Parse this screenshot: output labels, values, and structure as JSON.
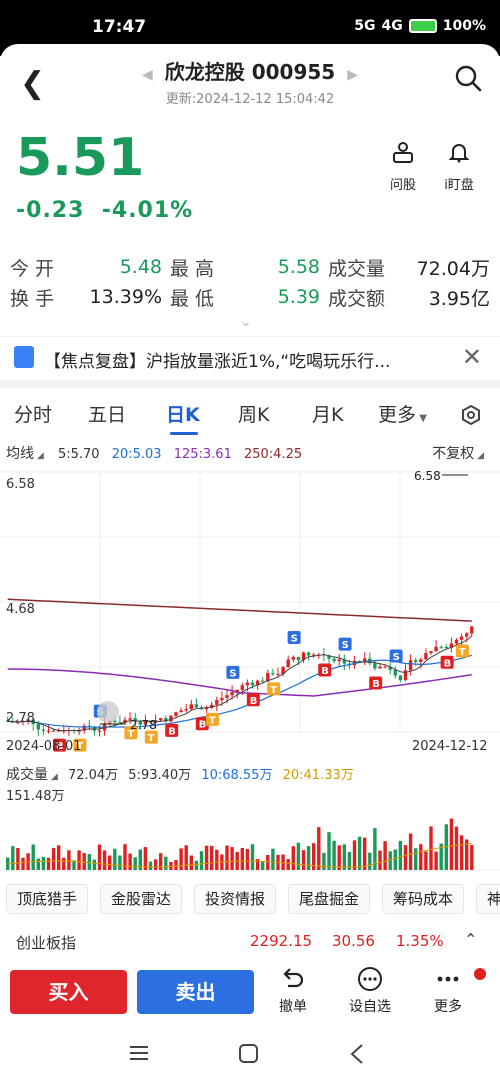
{
  "status": {
    "time": "17:47",
    "battery": "100%",
    "net1": "5G",
    "net2": "4G"
  },
  "header": {
    "title": "欣龙控股 000955",
    "updated": "更新:2024-12-12 15:04:42"
  },
  "quote": {
    "price": "5.51",
    "change": "-0.23",
    "change_pct": "-4.01%"
  },
  "actions": [
    {
      "label": "问股"
    },
    {
      "label": "i盯盘"
    }
  ],
  "stats": {
    "open_label": "今开",
    "open": "5.48",
    "high_label": "最高",
    "high": "5.58",
    "volume_label": "成交量",
    "volume": "72.04万",
    "turnover_label": "换手",
    "turnover": "13.39%",
    "low_label": "最低",
    "low": "5.39",
    "amount_label": "成交额",
    "amount": "3.95亿"
  },
  "news": {
    "text": "【焦点复盘】沪指放量涨近1%,“吃喝玩乐行..."
  },
  "tabs": [
    {
      "label": "分时"
    },
    {
      "label": "五日"
    },
    {
      "label": "日K"
    },
    {
      "label": "周K"
    },
    {
      "label": "月K"
    },
    {
      "label": "更多"
    }
  ],
  "ma": {
    "label": "均线",
    "ma5": "5:5.70",
    "ma20": "20:5.03",
    "ma125": "125:3.61",
    "ma250": "250:4.25",
    "adjust": "不复权"
  },
  "kline": {
    "y_top": "6.58",
    "y_mid": "4.68",
    "y_bottom": "2.78",
    "max_label": "6.58",
    "min_label": "2.78",
    "date_start": "2024-08-01",
    "date_end": "2024-12-12"
  },
  "volume_bar": {
    "label": "成交量",
    "total": "72.04万",
    "ma5": "5:93.40万",
    "ma10": "10:68.55万",
    "ma20": "20:41.33万",
    "ymax": "151.48万"
  },
  "tools": [
    {
      "label": "顶底猎手"
    },
    {
      "label": "金股雷达"
    },
    {
      "label": "投资情报"
    },
    {
      "label": "尾盘掘金"
    },
    {
      "label": "筹码成本"
    },
    {
      "label": "神"
    }
  ],
  "index": {
    "name": "创业板指",
    "value": "2292.15",
    "change": "30.56",
    "pct": "1.35%"
  },
  "bottom": {
    "buy": "买入",
    "sell": "卖出",
    "revoke": "撤单",
    "watch": "设自选",
    "more": "更多"
  },
  "colors": {
    "up": "#e02020",
    "down": "#1a9a5a",
    "accent": "#1f5fd6"
  }
}
